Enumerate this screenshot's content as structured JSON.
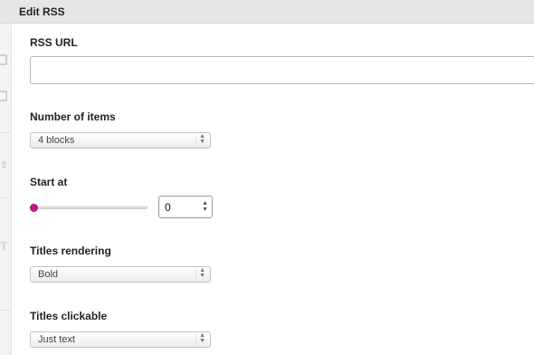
{
  "dialog": {
    "title": "Edit RSS"
  },
  "rss_url": {
    "label": "RSS URL",
    "value": "",
    "placeholder": ""
  },
  "number_of_items": {
    "label": "Number of items",
    "selected": "4 blocks"
  },
  "start_at": {
    "label": "Start at",
    "value": "0",
    "slider_fraction": 0
  },
  "titles_rendering": {
    "label": "Titles rendering",
    "selected": "Bold"
  },
  "titles_clickable": {
    "label": "Titles clickable",
    "selected": "Just text"
  },
  "colors": {
    "accent": "#c2187f",
    "header_bg": "#e6e6e6"
  },
  "icons": {
    "select_arrows": "updown-arrows-icon",
    "spinner": "spinner-arrows-icon"
  }
}
